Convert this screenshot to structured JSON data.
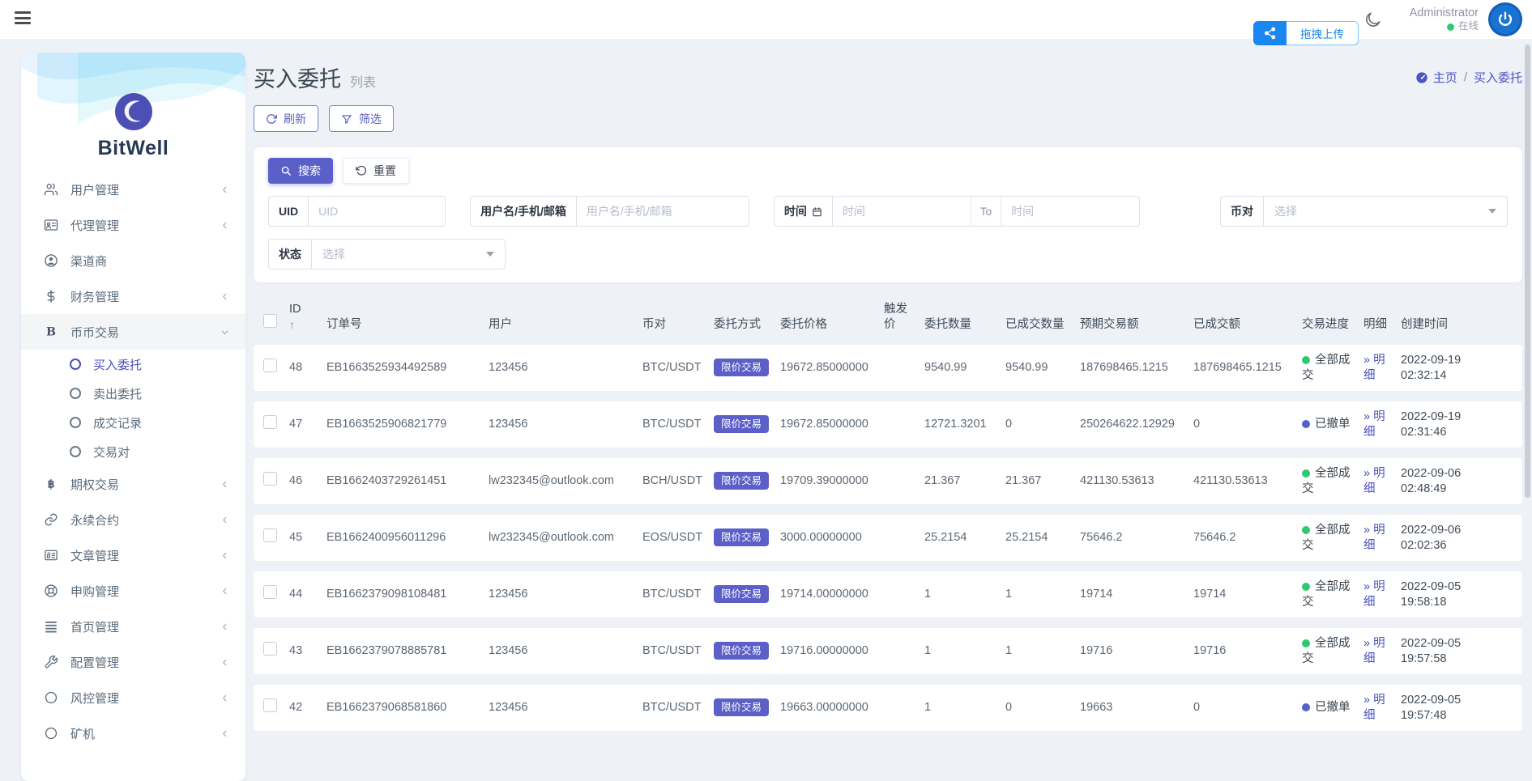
{
  "topbar": {
    "user_name": "Administrator",
    "user_status_label": "在线",
    "upload_button_label": "拖拽上传"
  },
  "sidebar": {
    "brand": "BitWell",
    "menu": [
      {
        "label": "用户管理"
      },
      {
        "label": "代理管理"
      },
      {
        "label": "渠道商"
      },
      {
        "label": "财务管理"
      },
      {
        "label": "币币交易"
      },
      {
        "label": "期权交易"
      },
      {
        "label": "永续合约"
      },
      {
        "label": "文章管理"
      },
      {
        "label": "申购管理"
      },
      {
        "label": "首页管理"
      },
      {
        "label": "配置管理"
      },
      {
        "label": "风控管理"
      },
      {
        "label": "矿机"
      }
    ],
    "submenu": [
      {
        "label": "买入委托"
      },
      {
        "label": "卖出委托"
      },
      {
        "label": "成交记录"
      },
      {
        "label": "交易对"
      }
    ]
  },
  "page": {
    "title": "买入委托",
    "subtitle": "列表",
    "breadcrumb_home": "主页",
    "breadcrumb_separator": "/",
    "breadcrumb_current": "买入委托",
    "refresh_label": "刷新",
    "filter_label": "筛选"
  },
  "search": {
    "search_label": "搜索",
    "reset_label": "重置",
    "uid_label": "UID",
    "uid_placeholder": "UID",
    "user_label": "用户名/手机/邮箱",
    "user_placeholder": "用户名/手机/邮箱",
    "time_label": "时间",
    "time_from_placeholder": "时间",
    "time_to_separator": "To",
    "time_to_placeholder": "时间",
    "pair_label": "币对",
    "pair_placeholder": "选择",
    "status_label": "状态",
    "status_placeholder": "选择"
  },
  "table": {
    "sort_indicator": "↑",
    "detail_prefix": "»",
    "detail_label": "明细",
    "headers": [
      "ID",
      "订单号",
      "用户",
      "币对",
      "委托方式",
      "委托价格",
      "触发价",
      "委托数量",
      "已成交数量",
      "预期交易额",
      "已成交额",
      "交易进度",
      "明细",
      "创建时间"
    ],
    "rows": [
      {
        "id": "48",
        "order_no": "EB1663525934492589",
        "user": "123456",
        "pair": "BTC/USDT",
        "order_type": "限价交易",
        "price": "19672.85000000",
        "trigger_price": "",
        "amount": "9540.99",
        "filled_amount": "9540.99",
        "expected_total": "187698465.1215",
        "dealt_total": "187698465.1215",
        "status": "全部成交",
        "status_type": "success",
        "created": "2022-09-19 02:32:14"
      },
      {
        "id": "47",
        "order_no": "EB1663525906821779",
        "user": "123456",
        "pair": "BTC/USDT",
        "order_type": "限价交易",
        "price": "19672.85000000",
        "trigger_price": "",
        "amount": "12721.3201",
        "filled_amount": "0",
        "expected_total": "250264622.12929",
        "dealt_total": "0",
        "status": "已撤单",
        "status_type": "canceled",
        "created": "2022-09-19 02:31:46"
      },
      {
        "id": "46",
        "order_no": "EB1662403729261451",
        "user": "lw232345@outlook.com",
        "pair": "BCH/USDT",
        "order_type": "限价交易",
        "price": "19709.39000000",
        "trigger_price": "",
        "amount": "21.367",
        "filled_amount": "21.367",
        "expected_total": "421130.53613",
        "dealt_total": "421130.53613",
        "status": "全部成交",
        "status_type": "success",
        "created": "2022-09-06 02:48:49"
      },
      {
        "id": "45",
        "order_no": "EB1662400956011296",
        "user": "lw232345@outlook.com",
        "pair": "EOS/USDT",
        "order_type": "限价交易",
        "price": "3000.00000000",
        "trigger_price": "",
        "amount": "25.2154",
        "filled_amount": "25.2154",
        "expected_total": "75646.2",
        "dealt_total": "75646.2",
        "status": "全部成交",
        "status_type": "success",
        "created": "2022-09-06 02:02:36"
      },
      {
        "id": "44",
        "order_no": "EB1662379098108481",
        "user": "123456",
        "pair": "BTC/USDT",
        "order_type": "限价交易",
        "price": "19714.00000000",
        "trigger_price": "",
        "amount": "1",
        "filled_amount": "1",
        "expected_total": "19714",
        "dealt_total": "19714",
        "status": "全部成交",
        "status_type": "success",
        "created": "2022-09-05 19:58:18"
      },
      {
        "id": "43",
        "order_no": "EB1662379078885781",
        "user": "123456",
        "pair": "BTC/USDT",
        "order_type": "限价交易",
        "price": "19716.00000000",
        "trigger_price": "",
        "amount": "1",
        "filled_amount": "1",
        "expected_total": "19716",
        "dealt_total": "19716",
        "status": "全部成交",
        "status_type": "success",
        "created": "2022-09-05 19:57:58"
      },
      {
        "id": "42",
        "order_no": "EB1662379068581860",
        "user": "123456",
        "pair": "BTC/USDT",
        "order_type": "限价交易",
        "price": "19663.00000000",
        "trigger_price": "",
        "amount": "1",
        "filled_amount": "0",
        "expected_total": "19663",
        "dealt_total": "0",
        "status": "已撤单",
        "status_type": "canceled",
        "created": "2022-09-05 19:57:48"
      }
    ]
  },
  "colors": {
    "accent": "#5a5fc9",
    "success": "#2ec96f",
    "canceled": "#5560c8",
    "upload_blue": "#1a86f0",
    "online_green": "#2ecc71"
  }
}
